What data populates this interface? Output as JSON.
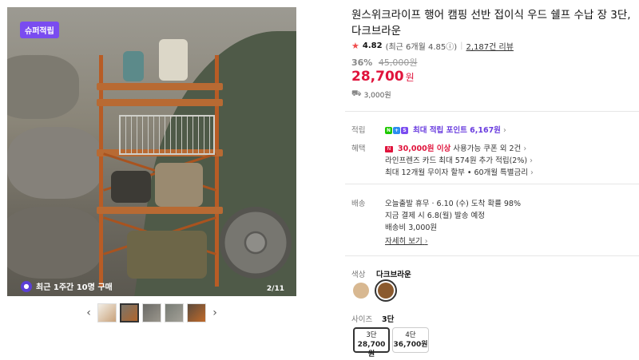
{
  "gallery": {
    "badge": "슈퍼적립",
    "recent_purchase": "최근 1주간 10명 구매",
    "page_indicator": "2/11"
  },
  "product": {
    "title": "원스위크라이프 행어 캠핑 선반 접이식 우드 쉘프 수납 장 3단, 다크브라운",
    "rating_score": "4.82",
    "rating_recent": "(최근 6개월 4.85",
    "rating_suffix": ")",
    "review_count": "2,187건 리뷰",
    "discount_pct": "36%",
    "original_price": "45,000원",
    "price": "28,700",
    "price_unit": "원",
    "shipping_fee": "3,000원"
  },
  "benefits": {
    "points_label": "적립",
    "points_text": "최대 적립 포인트 6,167원",
    "perks_label": "혜택",
    "coupon_amount": "30,000원 이상",
    "coupon_text": "사용가능 쿠폰 외 2건",
    "card_line": "라인프렌즈 카드 최대 574원 추가 적립(2%)",
    "installment_line": "최대 12개월 무이자 할부 • 60개월 특별금리"
  },
  "delivery": {
    "label": "배송",
    "line1": "오늘출발 휴무 · 6.10 (수) 도착 확률 98%",
    "line2": "지금 결제 시 6.8(월) 발송 예정",
    "line3": "배송비 3,000원",
    "detail_link": "자세히 보기"
  },
  "options": {
    "color_label": "색상",
    "color_value": "다크브라운",
    "swatches": [
      "#d8b891",
      "#8b5a2e"
    ],
    "size_label": "사이즈",
    "size_value": "3단",
    "sizes": [
      {
        "name": "3단",
        "price": "28,700원"
      },
      {
        "name": "4단",
        "price": "36,700원"
      }
    ]
  },
  "colors": {
    "accent_red": "#e0143c",
    "accent_purple": "#6a3ddf"
  }
}
